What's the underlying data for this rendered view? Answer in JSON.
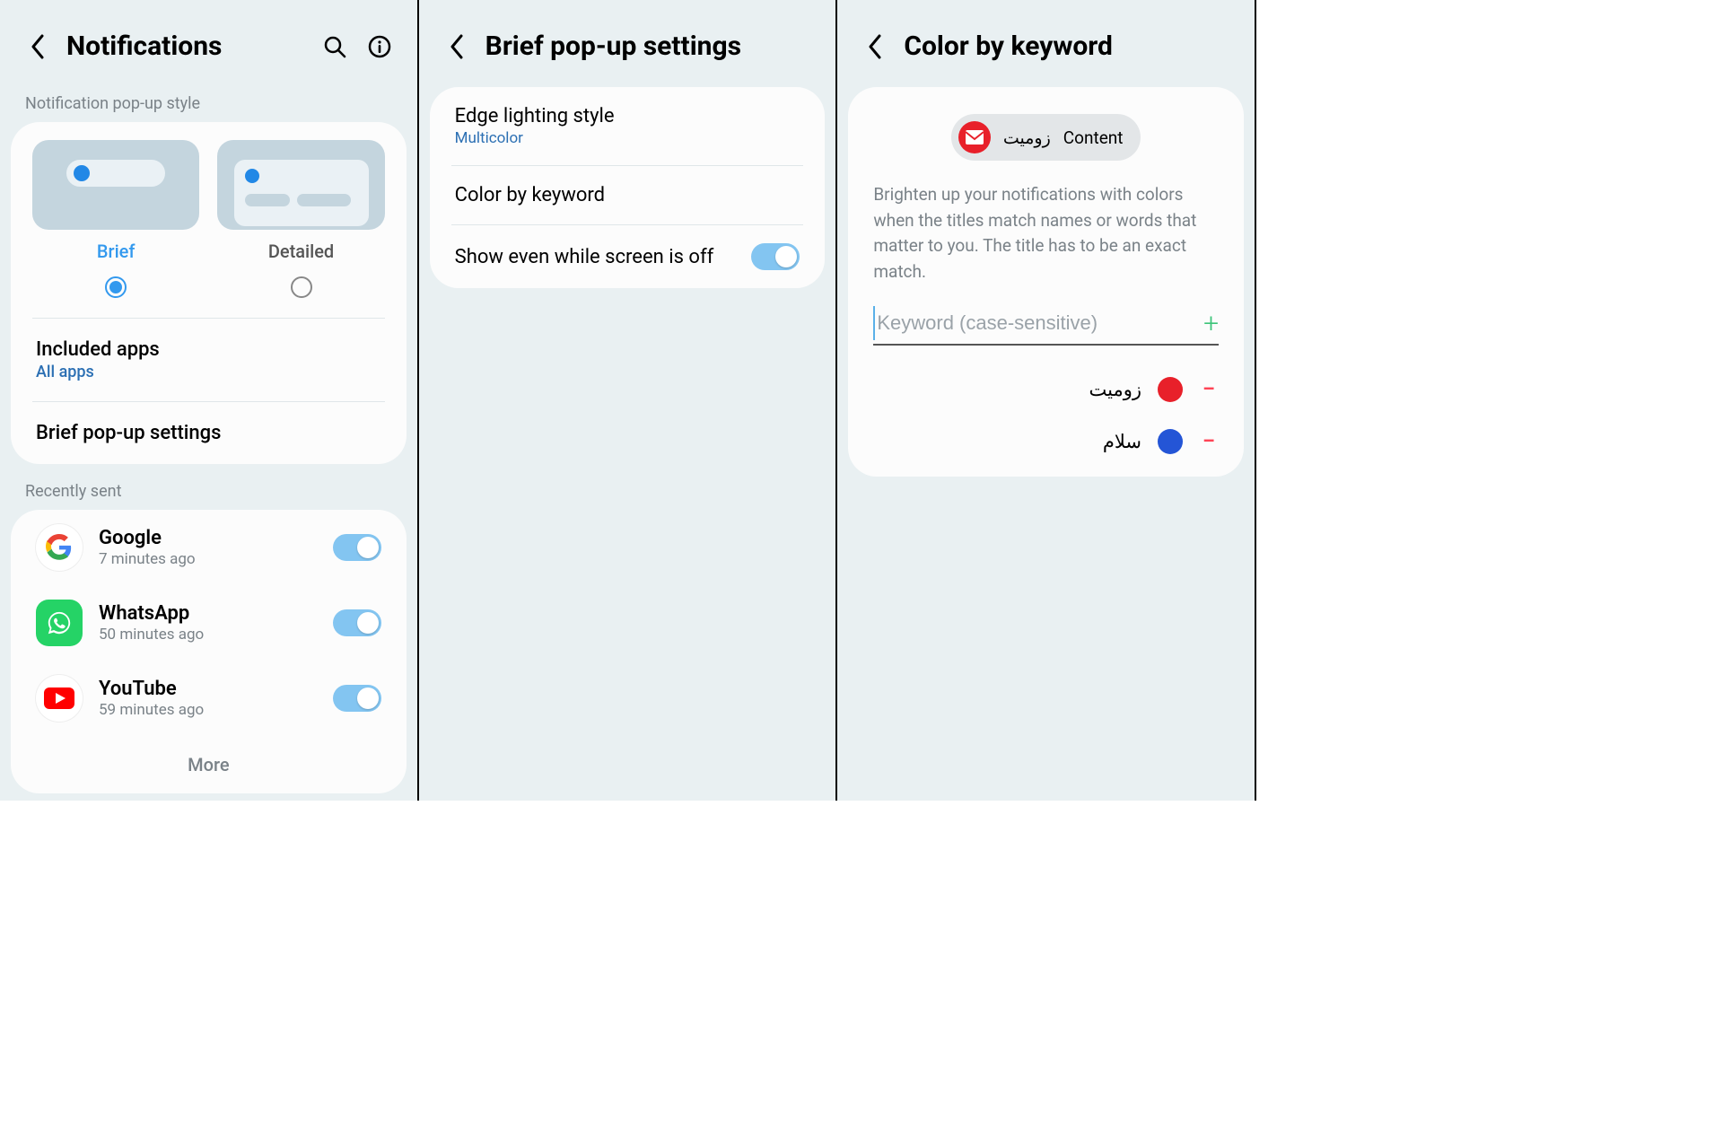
{
  "screen1": {
    "title": "Notifications",
    "section_style": "Notification pop-up style",
    "style_brief": "Brief",
    "style_detailed": "Detailed",
    "included_apps": "Included apps",
    "included_apps_sub": "All apps",
    "brief_popup": "Brief pop-up settings",
    "section_recent": "Recently sent",
    "apps": [
      {
        "name": "Google",
        "time": "7 minutes ago"
      },
      {
        "name": "WhatsApp",
        "time": "50 minutes ago"
      },
      {
        "name": "YouTube",
        "time": "59 minutes ago"
      }
    ],
    "more": "More"
  },
  "screen2": {
    "title": "Brief pop-up settings",
    "edge": "Edge lighting style",
    "edge_sub": "Multicolor",
    "color_kw": "Color by keyword",
    "show_off": "Show even while screen is off"
  },
  "screen3": {
    "title": "Color by keyword",
    "chip_a": "زومیت",
    "chip_b": "Content",
    "desc": "Brighten up your notifications with colors when the titles match names or words that matter to you. The title has to be an exact match.",
    "placeholder": "Keyword (case-sensitive)",
    "keywords": [
      {
        "text": "زومیت",
        "color": "#e8202a"
      },
      {
        "text": "سلام",
        "color": "#2455d6"
      }
    ]
  }
}
